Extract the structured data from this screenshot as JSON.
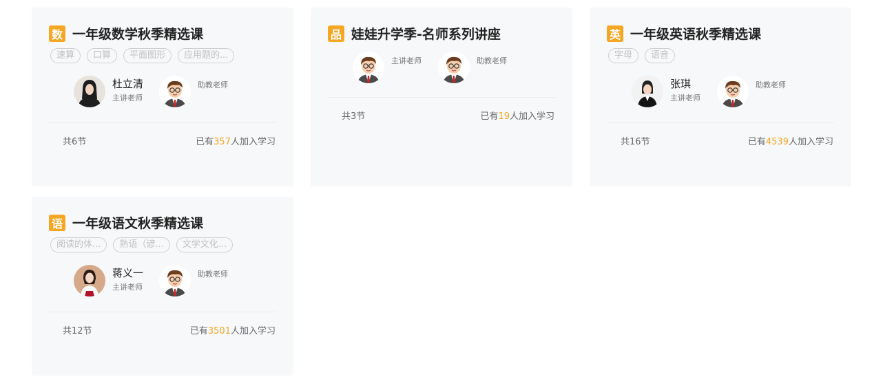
{
  "cards": [
    {
      "subject": "数",
      "title": "一年级数学秋季精选课",
      "tags": [
        "速算",
        "口算",
        "平面图形",
        "应用题的..."
      ],
      "teacher": {
        "name": "杜立清",
        "role": "主讲老师"
      },
      "assistant": {
        "role": "助教老师"
      },
      "lessons": "共6节",
      "joined_prefix": "已有",
      "joined_count": "357",
      "joined_suffix": "人加入学习"
    },
    {
      "subject": "品",
      "title": "娃娃升学季-名师系列讲座",
      "tags": [],
      "teacher": {
        "name": "",
        "role": "主讲老师"
      },
      "assistant": {
        "role": "助教老师"
      },
      "lessons": "共3节",
      "joined_prefix": "已有",
      "joined_count": "19",
      "joined_suffix": "人加入学习"
    },
    {
      "subject": "英",
      "title": "一年级英语秋季精选课",
      "tags": [
        "字母",
        "语音"
      ],
      "teacher": {
        "name": "张琪",
        "role": "主讲老师"
      },
      "assistant": {
        "role": "助教老师"
      },
      "lessons": "共16节",
      "joined_prefix": "已有",
      "joined_count": "4539",
      "joined_suffix": "人加入学习"
    },
    {
      "subject": "语",
      "title": "一年级语文秋季精选课",
      "tags": [
        "阅读的体...",
        "熟语（谚...",
        "文学文化..."
      ],
      "teacher": {
        "name": "蒋义一",
        "role": "主讲老师"
      },
      "assistant": {
        "role": "助教老师"
      },
      "lessons": "共12节",
      "joined_prefix": "已有",
      "joined_count": "3501",
      "joined_suffix": "人加入学习"
    }
  ],
  "colors": {
    "accent": "#f5a623",
    "card_bg": "#f7f8fa"
  },
  "icons": {
    "cartoon_teacher": "cartoon-teacher-avatar-icon"
  }
}
